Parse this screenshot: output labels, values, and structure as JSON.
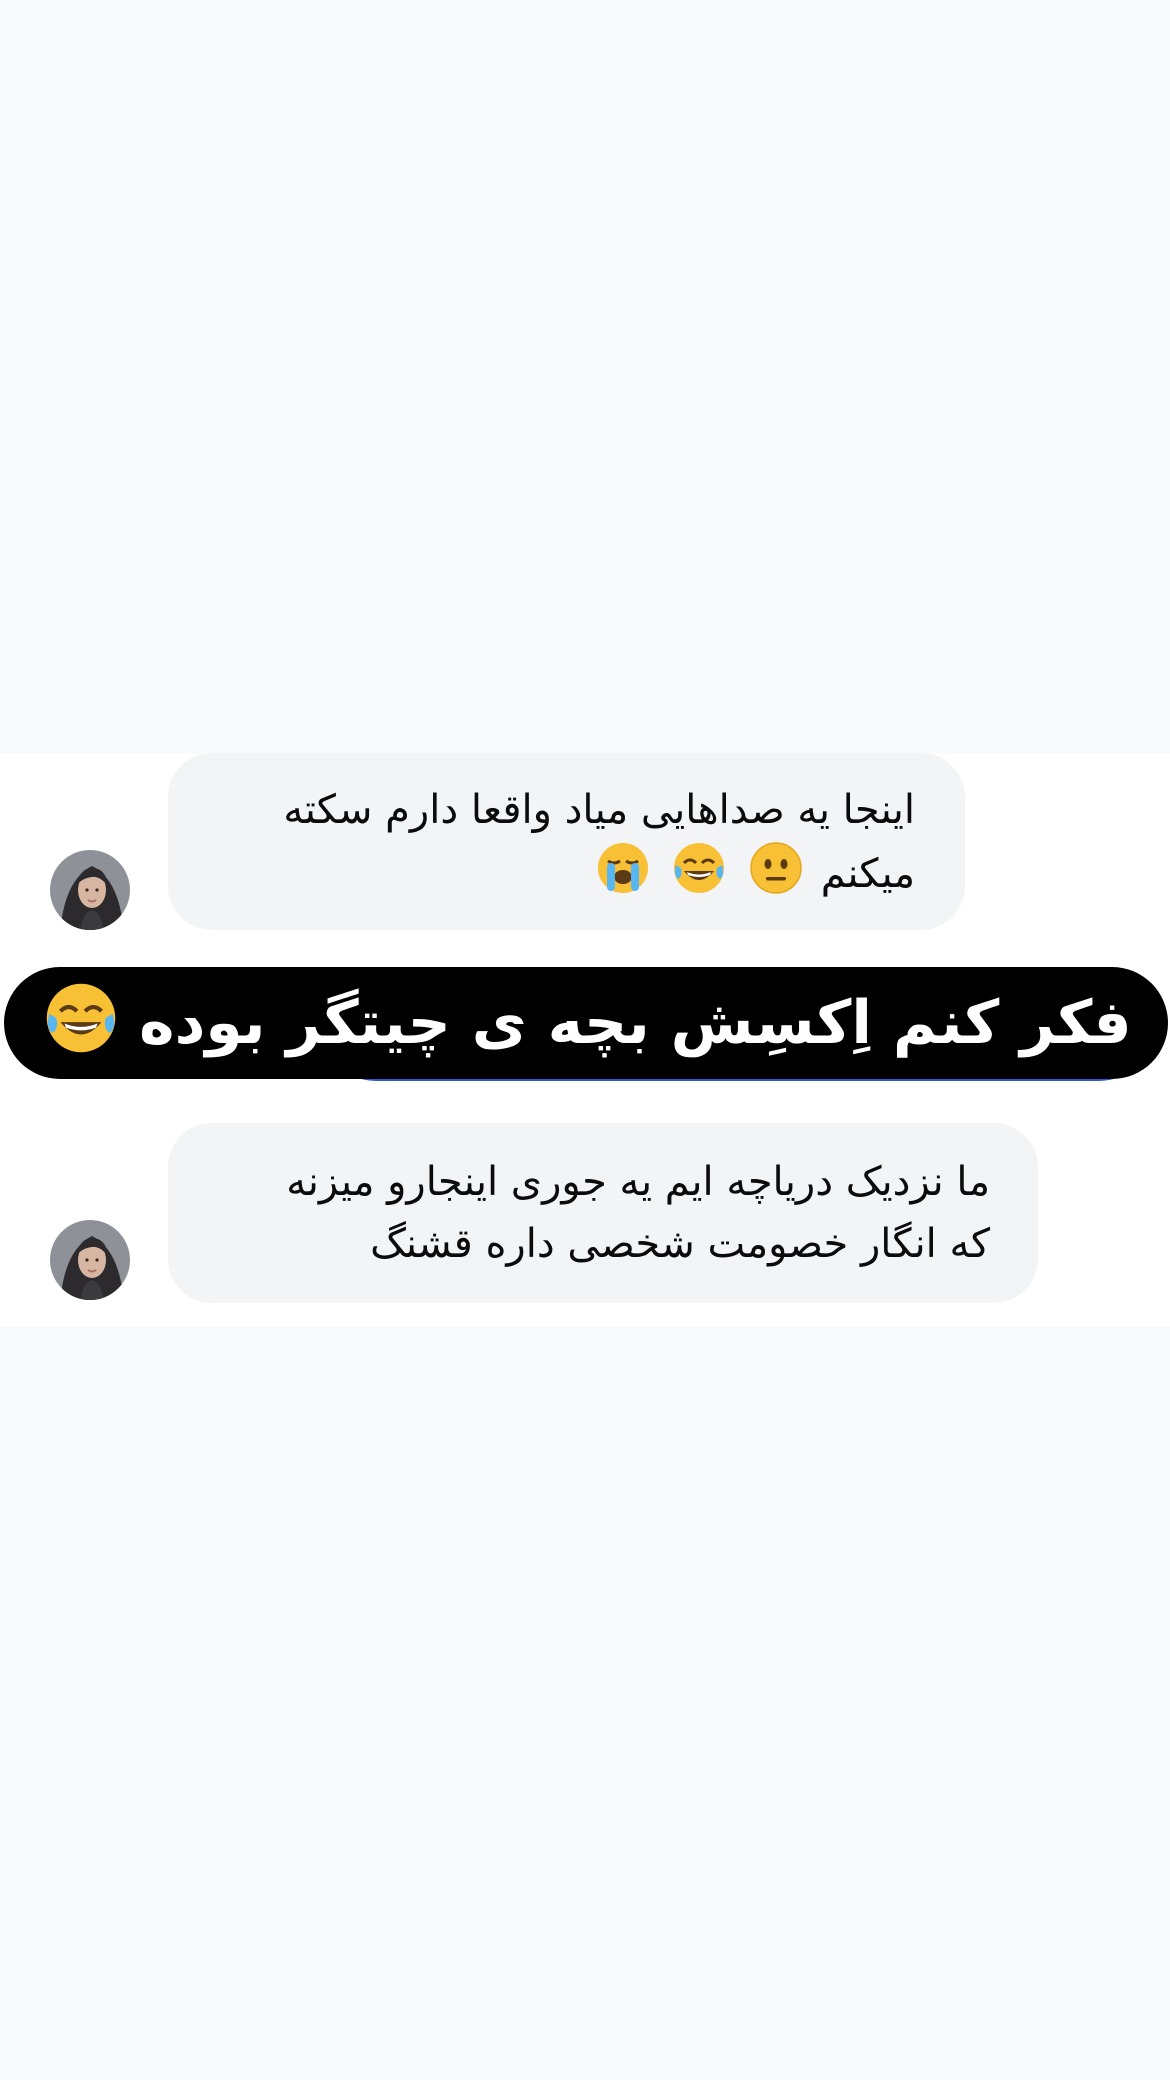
{
  "messages": [
    {
      "lines": [
        "اینجا یه صداهایی میاد واقعا دارم سکته",
        "میکنم"
      ],
      "emojis": [
        "neutral-face",
        "tears-of-joy",
        "loudly-crying-face"
      ]
    },
    {
      "lines": [
        "ما نزدیک دریاچه ایم یه جوری اینجارو میزنه",
        "که انگار خصومت شخصی داره قشنگ"
      ]
    }
  ],
  "overlay_caption": {
    "text": "فکر کنم اِکسِش بچه ی چیتگر بوده",
    "emoji": "tears-of-joy"
  },
  "colors": {
    "page_background": "#f8f9fa",
    "chat_background": "#ffffff",
    "bubble_background": "#f3f4f6",
    "overlay_background": "#000000",
    "overlay_accent": "#2f55d4",
    "text": "#0b0b0c"
  }
}
